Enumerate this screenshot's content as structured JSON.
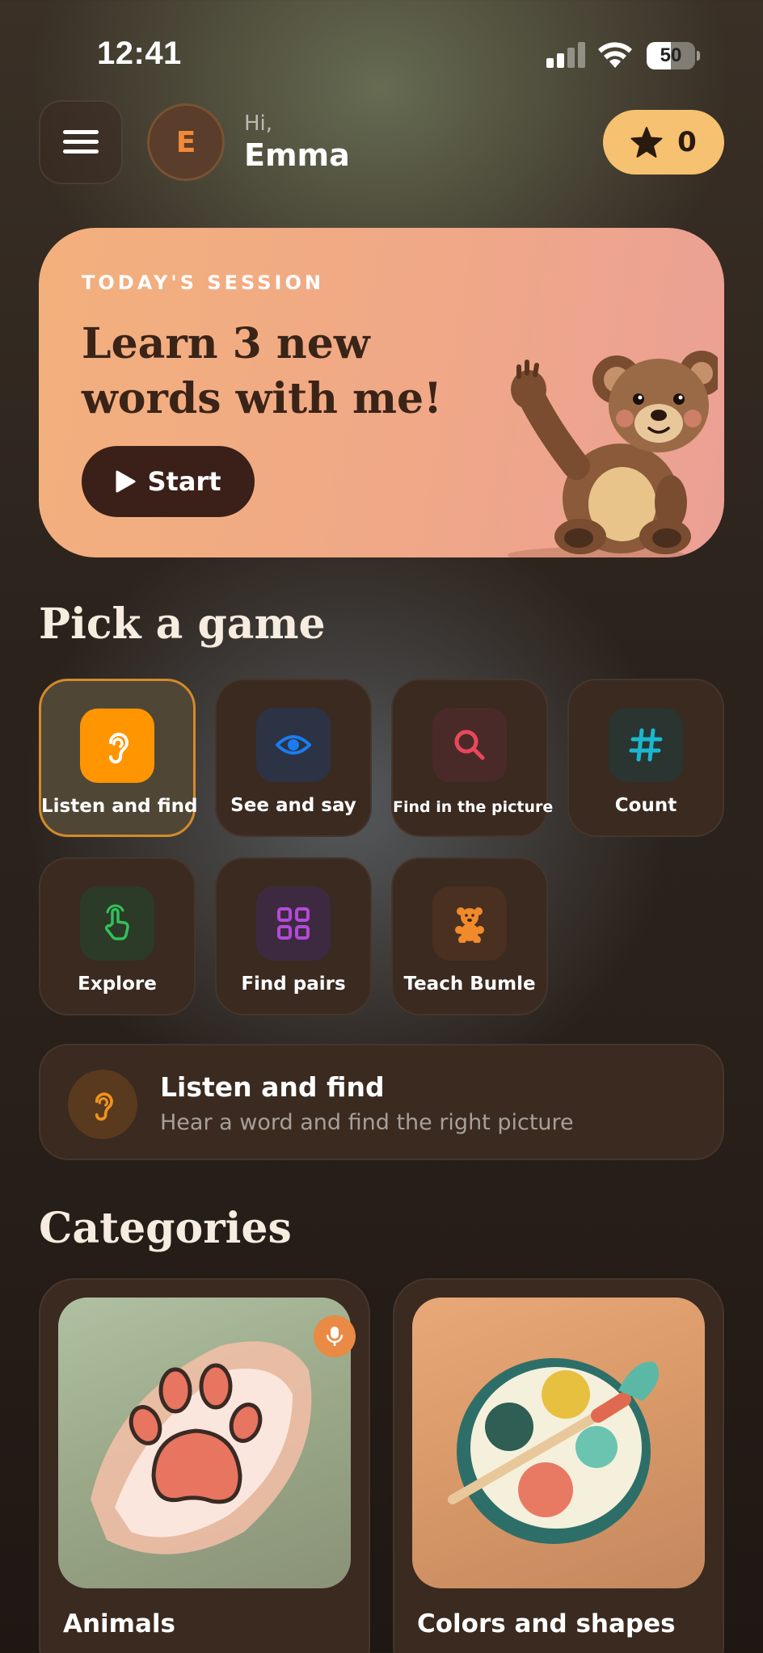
{
  "status_bar": {
    "time": "12:41",
    "battery_level": "50",
    "battery_fraction": 0.5,
    "icons": [
      "cellular-signal-icon",
      "wifi-icon",
      "battery-icon"
    ]
  },
  "header": {
    "menu_icon": "hamburger-menu-icon",
    "avatar_initial": "E",
    "greeting": "Hi,",
    "user_name": "Emma",
    "stars_icon": "star-icon",
    "stars_count": "0"
  },
  "session": {
    "eyebrow": "TODAY'S SESSION",
    "title": "Learn 3 new words with me!",
    "start_label": "Start",
    "start_icon": "play-icon",
    "illustration": "waving-teddy-bear"
  },
  "games": {
    "section_title": "Pick a game",
    "items": [
      {
        "label": "Listen and find",
        "icon": "ear-icon",
        "selected": true
      },
      {
        "label": "See and say",
        "icon": "eye-icon",
        "selected": false
      },
      {
        "label": "Find in the picture",
        "icon": "magnifier-icon",
        "selected": false
      },
      {
        "label": "Count",
        "icon": "hash-icon",
        "selected": false
      },
      {
        "label": "Explore",
        "icon": "tap-hand-icon",
        "selected": false
      },
      {
        "label": "Find pairs",
        "icon": "grid-icon",
        "selected": false
      },
      {
        "label": "Teach Bumle",
        "icon": "teddy-bear-icon",
        "selected": false
      }
    ]
  },
  "selected_game": {
    "title": "Listen and find",
    "description": "Hear a word and find the right picture",
    "icon": "ear-icon"
  },
  "categories": {
    "section_title": "Categories",
    "items": [
      {
        "label": "Animals",
        "image": "paw-print",
        "badge_icon": "microphone-icon"
      },
      {
        "label": "Colors and shapes",
        "image": "paint-palette"
      }
    ]
  },
  "colors": {
    "accent_orange": "#ff9500",
    "stars_badge": "#f6c170",
    "session_card": "#f0a887",
    "tile_background": "#3a2a20",
    "selected_border": "#d48a2a"
  }
}
